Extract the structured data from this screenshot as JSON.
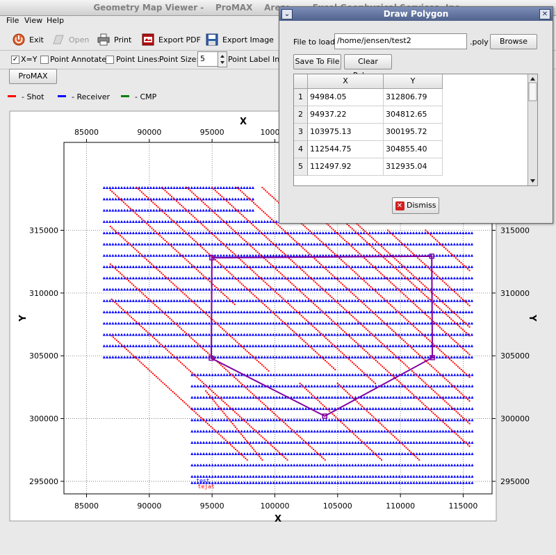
{
  "window": {
    "title": "Geometry Map Viewer -    ProMAX    Area:        Excel Geophysical Services, Inc."
  },
  "menu": [
    {
      "label": "File",
      "key": "file"
    },
    {
      "label": "View",
      "key": "view"
    },
    {
      "label": "Help",
      "key": "help"
    }
  ],
  "toolbar": {
    "exit": "Exit",
    "open": "Open",
    "print": "Print",
    "export_pdf": "Export PDF",
    "export_image": "Export Image"
  },
  "options": {
    "xy_label": "X=Y",
    "xy_checked": "✓",
    "point_annotate": "Point Annotate:",
    "point_lines": "Point Lines:",
    "point_size_label": "Point Size:",
    "point_size_value": "5",
    "point_label_incr": "Point Label Incr",
    "promax_button": "ProMAX"
  },
  "legend": [
    {
      "label": "- Shot",
      "color": "#ff0000"
    },
    {
      "label": "- Receiver",
      "color": "#0000ff"
    },
    {
      "label": "- CMP",
      "color": "#008000"
    }
  ],
  "dialog": {
    "title": "Draw Polygon",
    "file_label": "File to load:",
    "file_value": "/home/jensen/test2",
    "ext": ".poly",
    "browse": "Browse",
    "save": "Save To File",
    "clear": "Clear Polygon",
    "dismiss": "Dismiss",
    "col_x": "X",
    "col_y": "Y",
    "rows": [
      {
        "n": "1",
        "x": "94984.05",
        "y": "312806.79"
      },
      {
        "n": "2",
        "x": "94937.22",
        "y": "304812.65"
      },
      {
        "n": "3",
        "x": "103975.13",
        "y": "300195.72"
      },
      {
        "n": "4",
        "x": "112544.75",
        "y": "304855.40"
      },
      {
        "n": "5",
        "x": "112497.92",
        "y": "312935.04"
      }
    ]
  },
  "chart_data": {
    "type": "scatter",
    "xlabel": "X",
    "ylabel": "Y",
    "xlim": [
      83200,
      117300
    ],
    "ylim": [
      294000,
      322000
    ],
    "xticks": [
      85000,
      90000,
      95000,
      100000,
      105000,
      110000,
      115000
    ],
    "yticks": [
      295000,
      300000,
      305000,
      310000,
      315000
    ],
    "grid": true,
    "colors": {
      "shot": "#ff0000",
      "receiver": "#0000ff",
      "polygon": "#8000a0"
    },
    "receiver_lines": [
      {
        "x0": 86400,
        "x1": 98400,
        "y": 318400
      },
      {
        "x0": 86400,
        "x1": 98400,
        "y": 317500
      },
      {
        "x0": 86400,
        "x1": 98400,
        "y": 316600
      },
      {
        "x0": 86400,
        "x1": 115800,
        "y": 315700
      },
      {
        "x0": 86400,
        "x1": 115800,
        "y": 314800
      },
      {
        "x0": 86400,
        "x1": 115800,
        "y": 313900
      },
      {
        "x0": 86400,
        "x1": 115800,
        "y": 313000
      },
      {
        "x0": 86400,
        "x1": 115800,
        "y": 312100
      },
      {
        "x0": 86400,
        "x1": 115800,
        "y": 311200
      },
      {
        "x0": 86400,
        "x1": 115800,
        "y": 310300
      },
      {
        "x0": 86400,
        "x1": 115800,
        "y": 309400
      },
      {
        "x0": 86400,
        "x1": 115800,
        "y": 308500
      },
      {
        "x0": 86400,
        "x1": 115800,
        "y": 307600
      },
      {
        "x0": 86400,
        "x1": 115800,
        "y": 306700
      },
      {
        "x0": 86400,
        "x1": 115800,
        "y": 305800
      },
      {
        "x0": 86400,
        "x1": 115800,
        "y": 304900
      },
      {
        "x0": 93400,
        "x1": 115800,
        "y": 303500
      },
      {
        "x0": 93400,
        "x1": 115800,
        "y": 302600
      },
      {
        "x0": 93400,
        "x1": 115800,
        "y": 301700
      },
      {
        "x0": 93400,
        "x1": 115800,
        "y": 300800
      },
      {
        "x0": 93400,
        "x1": 115800,
        "y": 299900
      },
      {
        "x0": 93400,
        "x1": 115800,
        "y": 299000
      },
      {
        "x0": 93400,
        "x1": 115800,
        "y": 298100
      },
      {
        "x0": 93400,
        "x1": 115800,
        "y": 297200
      },
      {
        "x0": 93400,
        "x1": 115800,
        "y": 296300
      },
      {
        "x0": 93400,
        "x1": 115800,
        "y": 295400
      },
      {
        "x0": 93400,
        "x1": 115800,
        "y": 294900
      }
    ],
    "shot_lines": [
      {
        "x0": 86900,
        "y0": 318200,
        "x1": 96800,
        "y1": 309100
      },
      {
        "x0": 86900,
        "y0": 315300,
        "x1": 99500,
        "y1": 303800
      },
      {
        "x0": 86900,
        "y0": 312300,
        "x1": 104000,
        "y1": 296700
      },
      {
        "x0": 87000,
        "y0": 309500,
        "x1": 101000,
        "y1": 296700
      },
      {
        "x0": 87000,
        "y0": 306600,
        "x1": 97800,
        "y1": 296700
      },
      {
        "x0": 89000,
        "y0": 318400,
        "x1": 104800,
        "y1": 303900
      },
      {
        "x0": 91000,
        "y0": 318400,
        "x1": 108000,
        "y1": 302800
      },
      {
        "x0": 93000,
        "y0": 318400,
        "x1": 115500,
        "y1": 297800
      },
      {
        "x0": 95000,
        "y0": 318400,
        "x1": 115500,
        "y1": 299600
      },
      {
        "x0": 97000,
        "y0": 318400,
        "x1": 115500,
        "y1": 301400
      },
      {
        "x0": 99000,
        "y0": 318400,
        "x1": 115500,
        "y1": 303300
      },
      {
        "x0": 101000,
        "y0": 318400,
        "x1": 115500,
        "y1": 305100
      },
      {
        "x0": 103000,
        "y0": 318000,
        "x1": 115500,
        "y1": 306600
      },
      {
        "x0": 106000,
        "y0": 316000,
        "x1": 115500,
        "y1": 307300
      },
      {
        "x0": 109000,
        "y0": 315000,
        "x1": 115500,
        "y1": 309000
      },
      {
        "x0": 112000,
        "y0": 315000,
        "x1": 115500,
        "y1": 311800
      },
      {
        "x0": 102000,
        "y0": 302800,
        "x1": 108500,
        "y1": 296700
      },
      {
        "x0": 105000,
        "y0": 302800,
        "x1": 111500,
        "y1": 296700
      },
      {
        "x0": 94500,
        "y0": 302200,
        "x1": 99000,
        "y1": 296700
      }
    ],
    "polygon": [
      [
        94984.05,
        312806.79
      ],
      [
        94937.22,
        304812.65
      ],
      [
        103975.13,
        300195.72
      ],
      [
        112544.75,
        304855.4
      ],
      [
        112497.92,
        312935.04
      ]
    ],
    "point_labels": [
      {
        "text": "test",
        "x": 94800,
        "y": 294900,
        "color": "#0000ff"
      },
      {
        "text": "tejat",
        "x": 95200,
        "y": 294450,
        "color": "#ff0000"
      }
    ]
  }
}
